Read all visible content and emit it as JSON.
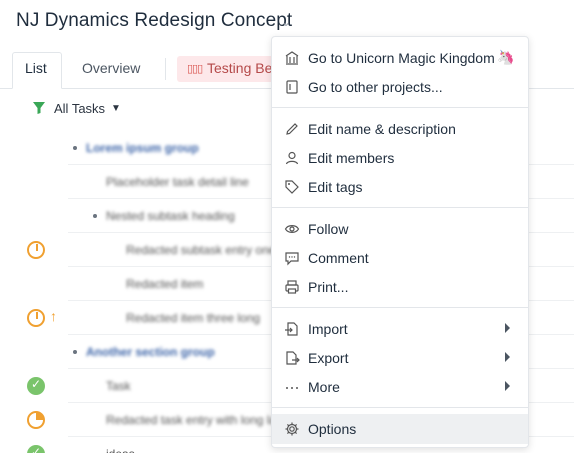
{
  "project": {
    "title": "NJ Dynamics Redesign Concept"
  },
  "tabs": [
    {
      "label": "List"
    },
    {
      "label": "Overview"
    },
    {
      "label": "Testing Be"
    }
  ],
  "filter": {
    "label": "All Tasks"
  },
  "rows": [
    {
      "label": "Lorem ipsum group",
      "kind": "group"
    },
    {
      "label": "Placeholder task detail line",
      "kind": "task"
    },
    {
      "label": "Nested subtask heading",
      "kind": "sub"
    },
    {
      "label": "Redacted subtask entry one",
      "kind": "subsub"
    },
    {
      "label": "Redacted item",
      "kind": "subsub"
    },
    {
      "label": "Redacted item three long",
      "kind": "subsub"
    },
    {
      "label": "Another section group",
      "kind": "group"
    },
    {
      "label": "Task",
      "kind": "task"
    },
    {
      "label": "Redacted task entry with long label",
      "kind": "task"
    },
    {
      "label": "ideas",
      "kind": "task"
    }
  ],
  "menu": {
    "items": [
      {
        "label": "Go to Unicorn Magic Kingdom",
        "icon": "building-icon"
      },
      {
        "label": "Go to other projects...",
        "icon": "project-icon"
      },
      {
        "label": "Edit name & description",
        "icon": "pencil-icon"
      },
      {
        "label": "Edit members",
        "icon": "person-icon"
      },
      {
        "label": "Edit tags",
        "icon": "tag-icon"
      },
      {
        "label": "Follow",
        "icon": "eye-icon"
      },
      {
        "label": "Comment",
        "icon": "comment-icon"
      },
      {
        "label": "Print...",
        "icon": "printer-icon"
      },
      {
        "label": "Import",
        "icon": "import-icon"
      },
      {
        "label": "Export",
        "icon": "export-icon"
      },
      {
        "label": "More",
        "icon": "ellipsis-icon"
      },
      {
        "label": "Options",
        "icon": "gear-icon"
      }
    ],
    "unicorn_emoji": "🦄"
  }
}
